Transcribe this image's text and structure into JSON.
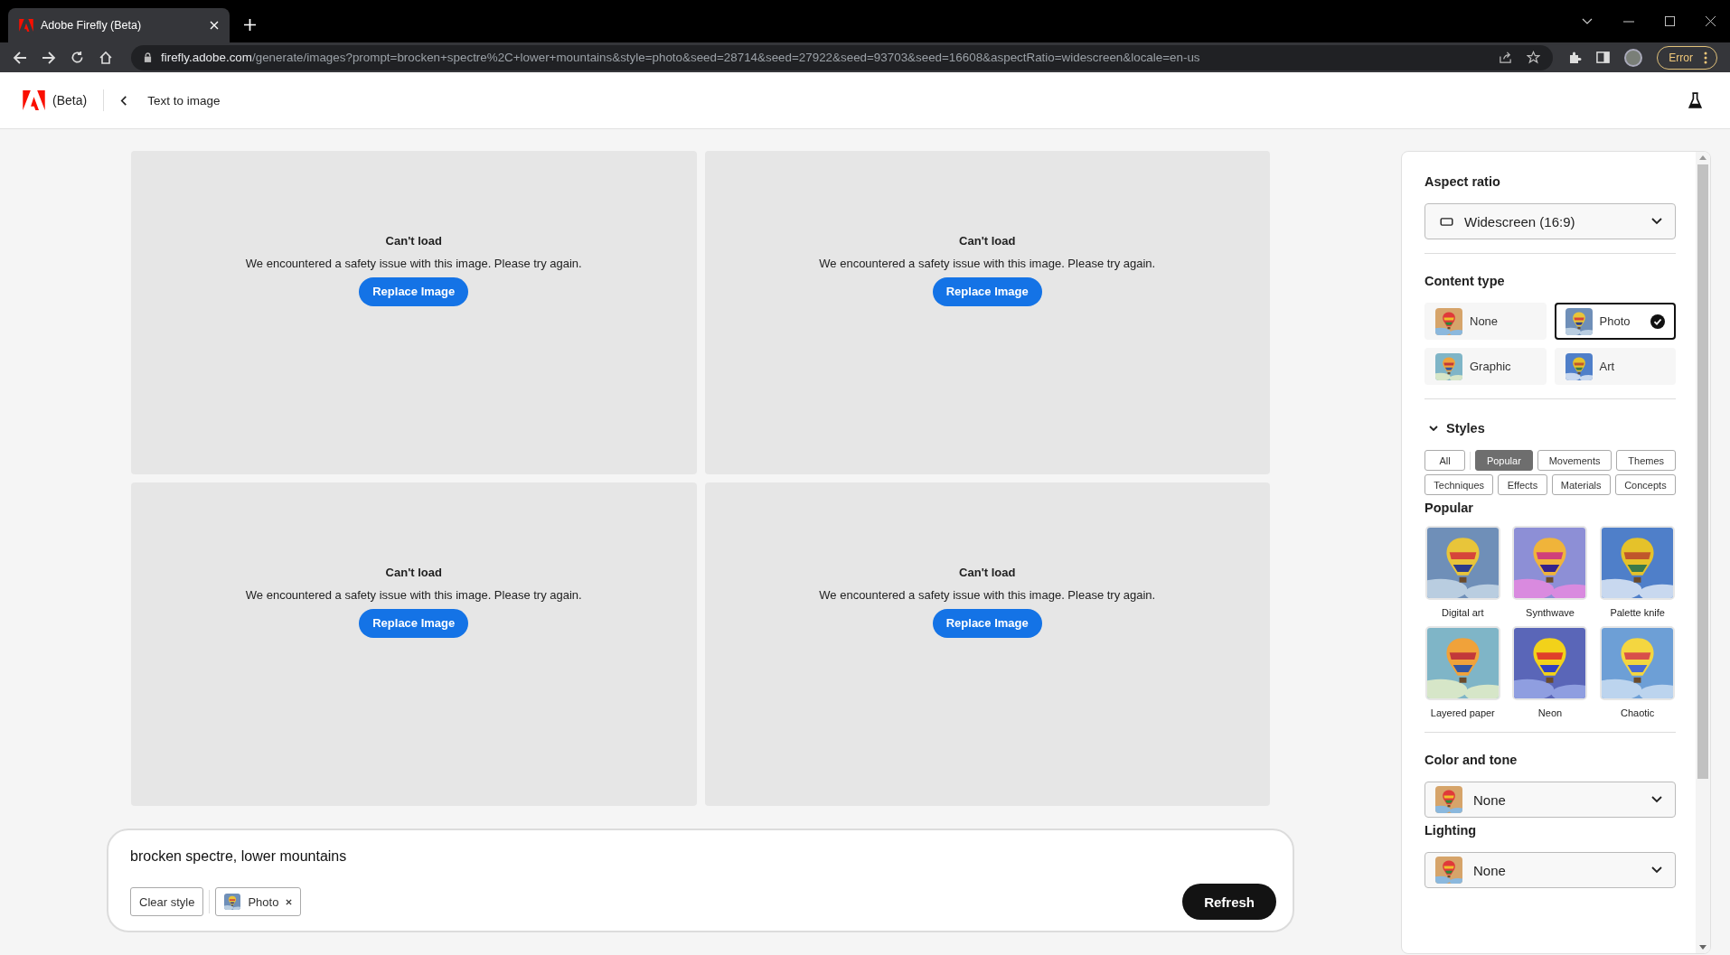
{
  "browser": {
    "tab_title": "Adobe Firefly (Beta)",
    "url_host": "firefly.adobe.com",
    "url_path": "/generate/images?prompt=brocken+spectre%2C+lower+mountains&style=photo&seed=28714&seed=27922&seed=93703&seed=16608&aspectRatio=widescreen&locale=en-us",
    "profile_button": "Error"
  },
  "header": {
    "badge": "(Beta)",
    "title": "Text to image"
  },
  "results": [
    {
      "title": "Can't load",
      "message": "We encountered a safety issue with this image. Please try again.",
      "button": "Replace Image"
    },
    {
      "title": "Can't load",
      "message": "We encountered a safety issue with this image. Please try again.",
      "button": "Replace Image"
    },
    {
      "title": "Can't load",
      "message": "We encountered a safety issue with this image. Please try again.",
      "button": "Replace Image"
    },
    {
      "title": "Can't load",
      "message": "We encountered a safety issue with this image. Please try again.",
      "button": "Replace Image"
    }
  ],
  "prompt": {
    "value": "brocken spectre, lower mountains",
    "chips": [
      {
        "label": "Clear style",
        "kind": "button"
      },
      {
        "label": "Photo",
        "kind": "tag"
      }
    ],
    "submit": "Refresh"
  },
  "panel": {
    "aspect_ratio": {
      "label": "Aspect ratio",
      "value": "Widescreen (16:9)"
    },
    "content_type": {
      "label": "Content type",
      "options": [
        {
          "label": "None",
          "selected": false
        },
        {
          "label": "Photo",
          "selected": true
        },
        {
          "label": "Graphic",
          "selected": false
        },
        {
          "label": "Art",
          "selected": false
        }
      ]
    },
    "styles": {
      "label": "Styles",
      "expanded": true,
      "filters": [
        {
          "label": "All",
          "selected": false
        },
        {
          "label": "Popular",
          "selected": true
        },
        {
          "label": "Movements",
          "selected": false
        },
        {
          "label": "Themes",
          "selected": false
        },
        {
          "label": "Techniques",
          "selected": false
        },
        {
          "label": "Effects",
          "selected": false
        },
        {
          "label": "Materials",
          "selected": false
        },
        {
          "label": "Concepts",
          "selected": false
        }
      ],
      "section_label": "Popular",
      "presets": [
        "Digital art",
        "Synthwave",
        "Palette knife",
        "Layered paper",
        "Neon",
        "Chaotic"
      ]
    },
    "color_tone": {
      "label": "Color and tone",
      "value": "None"
    },
    "lighting": {
      "label": "Lighting",
      "value": "None"
    }
  }
}
